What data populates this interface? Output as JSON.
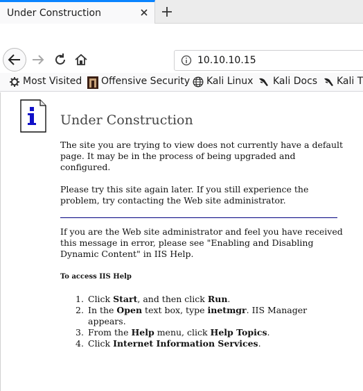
{
  "tab": {
    "title": "Under Construction"
  },
  "navigation": {
    "url": "10.10.10.15"
  },
  "bookmarks": [
    {
      "label": "Most Visited",
      "icon": "gear-icon"
    },
    {
      "label": "Offensive Security",
      "icon": "offsec-icon"
    },
    {
      "label": "Kali Linux",
      "icon": "globe-icon"
    },
    {
      "label": "Kali Docs",
      "icon": "kali-dragon-icon"
    },
    {
      "label": "Kali T",
      "icon": "kali-dragon-icon"
    }
  ],
  "content": {
    "heading": "Under Construction",
    "paragraph1": "The site you are trying to view does not currently have a default page. It may be in the process of being upgraded and configured.",
    "paragraph2": "Please try this site again later. If you still experience the problem, try contacting the Web site administrator.",
    "paragraph3": "If you are the Web site administrator and feel you have received this message in error, please see \"Enabling and Disabling Dynamic Content\" in IIS Help.",
    "help_heading": "To access IIS Help",
    "steps": [
      {
        "num": "1.",
        "parts": [
          "Click ",
          "Start",
          ", and then click ",
          "Run",
          "."
        ]
      },
      {
        "num": "2.",
        "parts": [
          "In the ",
          "Open",
          " text box, type ",
          "inetmgr",
          ". IIS Manager appears."
        ]
      },
      {
        "num": "3.",
        "parts": [
          "From the ",
          "Help",
          " menu, click ",
          "Help Topics",
          "."
        ]
      },
      {
        "num": "4.",
        "parts": [
          "Click ",
          "Internet Information Services",
          "."
        ]
      }
    ]
  }
}
